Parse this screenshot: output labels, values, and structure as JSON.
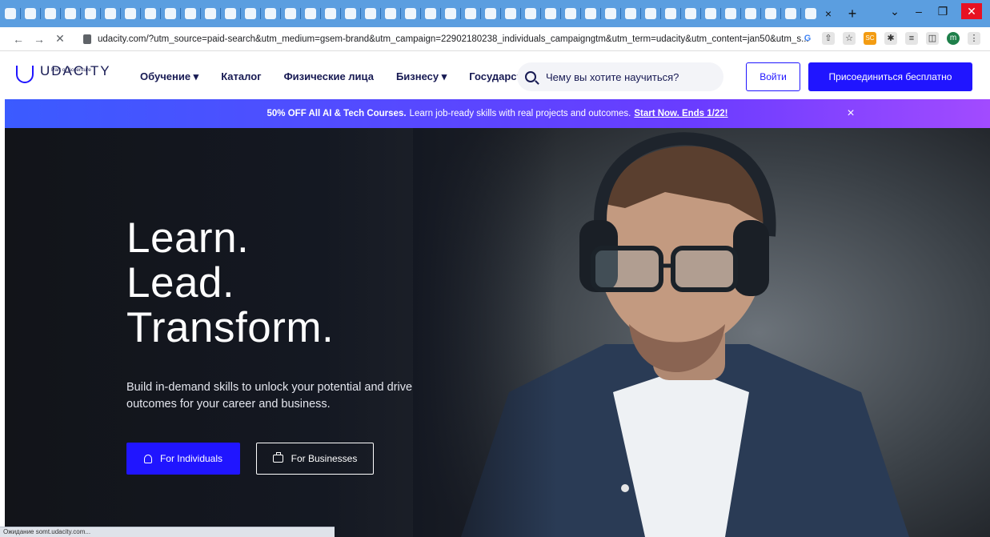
{
  "browser": {
    "url": "udacity.com/?utm_source=paid-search&utm_medium=gsem-brand&utm_campaign=22902180238_individuals_campaigngtm&utm_term=udacity&utm_content=jan50&utm_s...",
    "tab_close": "×",
    "new_tab": "+",
    "back": "←",
    "forward": "→",
    "stop": "✕",
    "status": "Ожидание somt.udacity.com...",
    "window": {
      "chevron": "⌄",
      "minimize": "–",
      "maximize": "❐",
      "close": "✕"
    },
    "toolbar": {
      "google": "G",
      "share": "⇧",
      "star": "☆",
      "sc": "SC",
      "puzzle": "✱",
      "list": "≡",
      "sidebar": "◫",
      "avatar": "m",
      "menu": "⋮"
    }
  },
  "header": {
    "logo_text": "UDACITY",
    "logo_sub": "Part of Accenture",
    "nav": [
      {
        "label": "Обучение ▾"
      },
      {
        "label": "Каталог"
      },
      {
        "label": "Физические лица"
      },
      {
        "label": "Бизнесу ▾"
      },
      {
        "label": "Государст"
      }
    ],
    "search_placeholder": "Чему вы хотите научиться?",
    "login_label": "Войти",
    "join_label": "Присоединиться бесплатно"
  },
  "promo": {
    "bold": "50% OFF All AI & Tech Courses.",
    "text": "Learn job-ready skills with real projects and outcomes.",
    "link": "Start Now. Ends 1/22!",
    "close": "×"
  },
  "hero": {
    "title_lines": [
      "Learn.",
      "Lead.",
      "Transform."
    ],
    "subtitle": "Build in-demand skills to unlock your potential and drive outcomes for your career and business.",
    "btn_individuals": "For Individuals",
    "btn_businesses": "For Businesses"
  },
  "colors": {
    "brand": "#2015ff",
    "nav_text": "#171a53",
    "tab_strip": "#5b9ee0"
  }
}
